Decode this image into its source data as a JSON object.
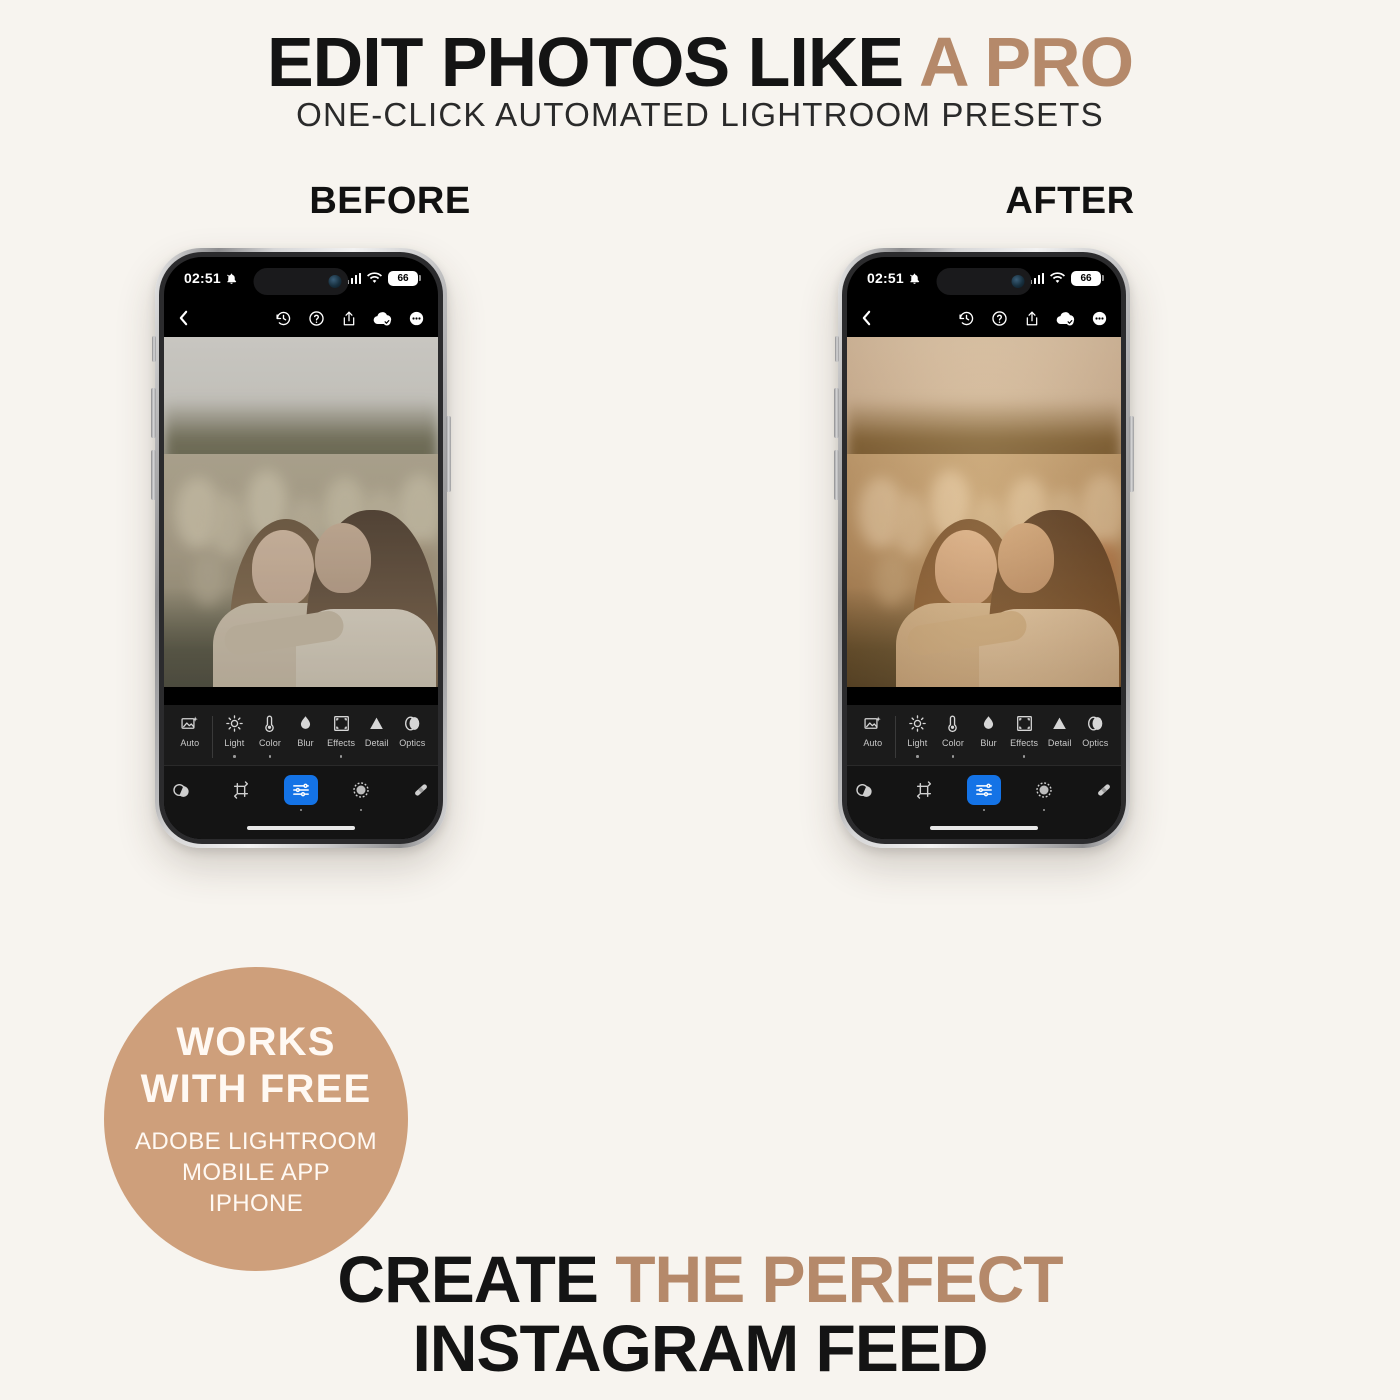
{
  "theme": {
    "background": "#F7F4EF",
    "accent": "#B5896A",
    "badge_fill": "#CE9F7B",
    "text_dark": "#141414",
    "app_blue": "#1473E6"
  },
  "header": {
    "title_part1": "EDIT PHOTOS LIKE ",
    "title_accent": "A PRO",
    "subtitle": "ONE-CLICK AUTOMATED LIGHTROOM PRESETS"
  },
  "comparison": {
    "before_label": "BEFORE",
    "after_label": "AFTER"
  },
  "footer": {
    "line1_part1": "CREATE ",
    "line1_accent": "THE PERFECT",
    "line2": "INSTAGRAM FEED"
  },
  "badge": {
    "line1": "WORKS",
    "line2": "WITH FREE",
    "detail1": "ADOBE LIGHTROOM",
    "detail2": "MOBILE APP",
    "detail3": "IPHONE"
  },
  "phone": {
    "status": {
      "time": "02:51",
      "mute_icon": "bell-slash-icon",
      "signal_icon": "cellular-signal-icon",
      "wifi_icon": "wifi-icon",
      "battery_level": "66"
    },
    "top_toolbar": {
      "back_icon": "back-chevron-icon",
      "items": [
        {
          "icon": "version-history-icon"
        },
        {
          "icon": "help-circle-icon"
        },
        {
          "icon": "share-icon"
        },
        {
          "icon": "cloud-synced-icon"
        },
        {
          "icon": "more-options-icon"
        }
      ]
    },
    "tool_row": [
      {
        "label": "Auto",
        "icon": "auto-enhance-icon",
        "has_dot": false
      },
      {
        "label": "Light",
        "icon": "brightness-icon",
        "has_dot": true
      },
      {
        "label": "Color",
        "icon": "thermometer-icon",
        "has_dot": true
      },
      {
        "label": "Blur",
        "icon": "water-drop-icon",
        "has_dot": false
      },
      {
        "label": "Effects",
        "icon": "effects-frame-icon",
        "has_dot": true
      },
      {
        "label": "Detail",
        "icon": "detail-triangle-icon",
        "has_dot": false
      },
      {
        "label": "Optics",
        "icon": "optics-lens-icon",
        "has_dot": false
      }
    ],
    "mode_row": [
      {
        "icon": "presets-icon",
        "active": false,
        "has_dot": false
      },
      {
        "icon": "crop-icon",
        "active": false,
        "has_dot": false
      },
      {
        "icon": "edit-sliders-icon",
        "active": true,
        "has_dot": true
      },
      {
        "icon": "masking-icon",
        "active": false,
        "has_dot": true
      },
      {
        "icon": "healing-brush-icon",
        "active": false,
        "has_dot": false
      }
    ]
  }
}
